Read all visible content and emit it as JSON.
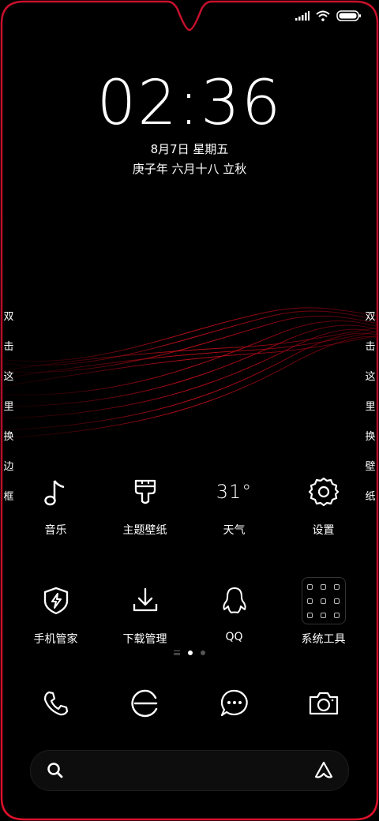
{
  "status_bar": {
    "icons": [
      "signal-icon",
      "wifi-icon",
      "battery-icon"
    ]
  },
  "lockclock": {
    "time": "02:36",
    "date": "8月7日 星期五",
    "lunar": "庚子年 六月十八 立秋"
  },
  "side_left": [
    "双",
    "击",
    "这",
    "里",
    "换",
    "边",
    "框"
  ],
  "side_right": [
    "双",
    "击",
    "这",
    "里",
    "换",
    "壁",
    "纸"
  ],
  "apps": [
    {
      "label": "音乐",
      "icon": "music-note-icon"
    },
    {
      "label": "主题壁纸",
      "icon": "paint-brush-icon"
    },
    {
      "label": "天气",
      "icon": "weather-temp",
      "temp": "31°"
    },
    {
      "label": "设置",
      "icon": "gear-icon"
    },
    {
      "label": "手机管家",
      "icon": "shield-bolt-icon"
    },
    {
      "label": "下载管理",
      "icon": "download-icon"
    },
    {
      "label": "QQ",
      "icon": "qq-penguin-icon"
    },
    {
      "label": "系统工具",
      "icon": "tools-folder-icon"
    }
  ],
  "pager": {
    "pages": 3,
    "active": 1
  },
  "dock": [
    "phone-icon",
    "browser-icon",
    "messages-icon",
    "camera-icon"
  ],
  "search": {
    "placeholder": ""
  },
  "colors": {
    "frame_red": "#e0102c",
    "background": "#000000",
    "text": "#ffffff"
  }
}
